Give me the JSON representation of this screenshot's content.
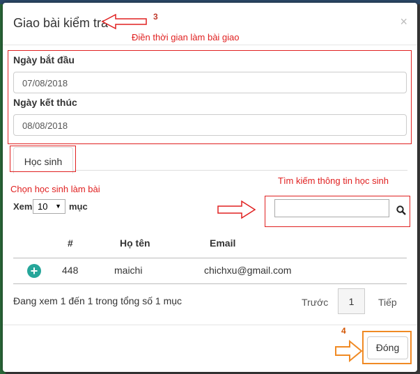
{
  "modal": {
    "title": "Giao bài kiểm tra",
    "close_symbol": "×"
  },
  "annotations": {
    "step3_number": "3",
    "step3_text": "Điền thời gian làm bài giao",
    "choose_students": "Chọn học sinh làm bài",
    "search_hint": "Tìm kiếm thông tin học sinh",
    "step4_number": "4"
  },
  "form": {
    "start_label": "Ngày bắt đầu",
    "start_value": "07/08/2018",
    "end_label": "Ngày kết thúc",
    "end_value": "08/08/2018"
  },
  "tabs": [
    {
      "label": "Học sinh",
      "active": true
    }
  ],
  "table": {
    "show_prefix": "Xem",
    "page_size": "10",
    "show_suffix": "mục",
    "columns": [
      "#",
      "Họ tên",
      "Email"
    ],
    "rows": [
      {
        "id": "448",
        "name": "maichi",
        "email": "chichxu@gmail.com"
      }
    ],
    "info": "Đang xem 1 đến 1 trong tổng số 1 mục",
    "prev": "Trước",
    "current_page": "1",
    "next": "Tiếp"
  },
  "search": {
    "value": ""
  },
  "footer": {
    "close_label": "Đóng"
  },
  "colors": {
    "annotation_red": "#e02020",
    "annotation_orange": "#f08a24",
    "add_icon": "#26a69a"
  },
  "icons": [
    "close-icon",
    "search-icon",
    "plus-circle-icon",
    "chevron-down-icon",
    "arrow-left-icon",
    "arrow-right-icon"
  ]
}
